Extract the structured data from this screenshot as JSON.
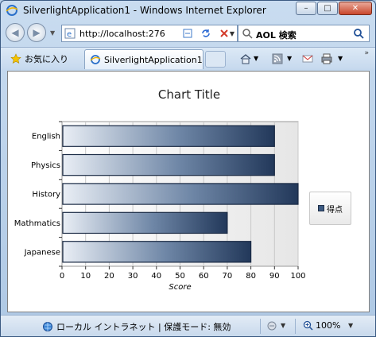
{
  "window": {
    "title": "SilverlightApplication1 - Windows Internet Explorer"
  },
  "address_bar": {
    "url": "http://localhost:276",
    "search_label": "AOL 検索"
  },
  "favorites": {
    "label": "お気に入り"
  },
  "tab": {
    "label": "SilverlightApplication1"
  },
  "status": {
    "zone_text": "ローカル イントラネット | 保護モード: 無効",
    "zoom": "100%"
  },
  "colors": {
    "bar_dark": "#22385a",
    "bar_light": "#e9eef5",
    "plot_bg": "#ebebeb",
    "accent_close": "#c9462c"
  },
  "chart_data": {
    "type": "bar",
    "orientation": "horizontal",
    "title": "Chart Title",
    "categories": [
      "English",
      "Physics",
      "History",
      "Mathmatics",
      "Japanese"
    ],
    "series": [
      {
        "name": "得点",
        "values": [
          90,
          90,
          100,
          70,
          80
        ]
      }
    ],
    "xlabel": "Score",
    "ylabel": "",
    "xlim": [
      0,
      100
    ],
    "xticks": [
      "0",
      "10",
      "20",
      "30",
      "40",
      "50",
      "60",
      "70",
      "80",
      "90",
      "100"
    ],
    "grid": true,
    "legend_position": "right"
  }
}
